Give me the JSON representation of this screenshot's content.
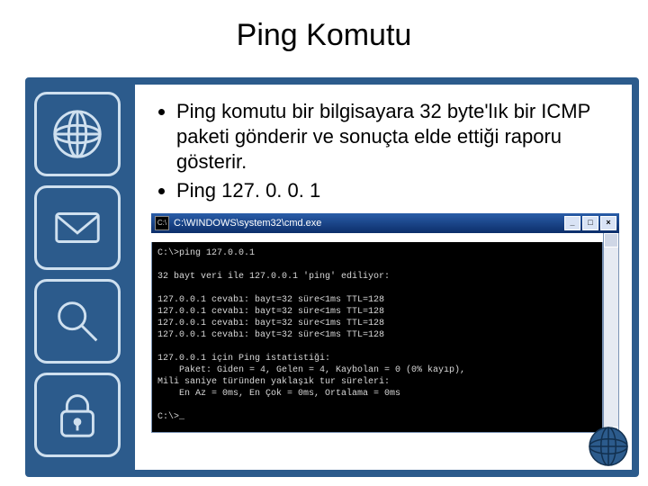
{
  "title": "Ping Komutu",
  "bullets": [
    "Ping komutu bir bilgisayara 32 byte'lık bir ICMP paketi gönderir ve sonuçta elde ettiği raporu gösterir.",
    "Ping 127. 0. 0. 1"
  ],
  "sidebar_icons": [
    "globe-icon",
    "mail-icon",
    "search-icon",
    "lock-icon"
  ],
  "cmd": {
    "window_title": "C:\\WINDOWS\\system32\\cmd.exe",
    "btn_min": "_",
    "btn_max": "□",
    "btn_close": "×",
    "lines": [
      "C:\\>ping 127.0.0.1",
      "",
      "32 bayt veri ile 127.0.0.1 'ping' ediliyor:",
      "",
      "127.0.0.1 cevabı: bayt=32 süre<1ms TTL=128",
      "127.0.0.1 cevabı: bayt=32 süre<1ms TTL=128",
      "127.0.0.1 cevabı: bayt=32 süre<1ms TTL=128",
      "127.0.0.1 cevabı: bayt=32 süre<1ms TTL=128",
      "",
      "127.0.0.1 için Ping istatistiği:",
      "    Paket: Giden = 4, Gelen = 4, Kaybolan = 0 (0% kayıp),",
      "Mili saniye türünden yaklaşık tur süreleri:",
      "    En Az = 0ms, En Çok = 0ms, Ortalama = 0ms",
      "",
      "C:\\>_"
    ]
  }
}
